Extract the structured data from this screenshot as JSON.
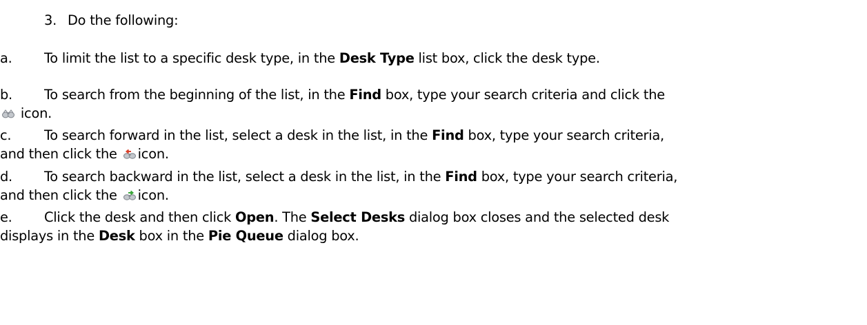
{
  "heading": {
    "number": "3.",
    "text": "Do the following:"
  },
  "items": [
    {
      "letter": "a.",
      "line1": [
        "To limit the list to a specific desk type, in the ",
        "Desk Type",
        " list box, click the desk type."
      ]
    },
    {
      "letter": "b.",
      "line1": [
        "To search from the beginning of the list, in the ",
        "Find",
        " box, type your search criteria and click the"
      ],
      "icon": "binoculars-icon",
      "line2_after": "icon."
    },
    {
      "letter": "c.",
      "line1": [
        "To search forward in the list, select a desk in the list, in the ",
        "Find",
        " box, type your search criteria,"
      ],
      "line2_before": "and then click the ",
      "icon": "find-previous-binoculars-icon",
      "line2_after": "icon."
    },
    {
      "letter": "d.",
      "line1": [
        "To search backward in the list, select a desk in the list, in the ",
        "Find",
        " box, type your search criteria,"
      ],
      "line2_before": "and then click the ",
      "icon": "find-next-binoculars-icon",
      "line2_after": "icon."
    },
    {
      "letter": "e.",
      "line1": [
        "Click the desk and then click ",
        "Open",
        ". The ",
        "Select Desks",
        " dialog box closes and the selected desk"
      ],
      "line2": [
        "displays in the ",
        "Desk",
        " box in the ",
        "Pie Queue",
        " dialog box."
      ]
    }
  ],
  "colors": {
    "text": "#000000",
    "background": "#ffffff",
    "icon_grey": "#8a8f96",
    "icon_red_arrow": "#d9412b",
    "icon_green_arrow": "#3aa63a"
  }
}
